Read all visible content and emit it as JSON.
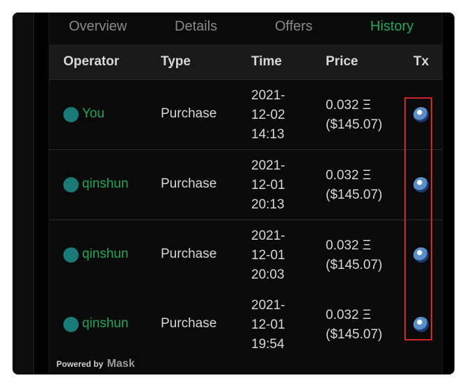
{
  "tabs": [
    "Overview",
    "Details",
    "Offers",
    "History"
  ],
  "active_tab": "History",
  "columns": {
    "operator": "Operator",
    "type": "Type",
    "time": "Time",
    "price": "Price",
    "tx": "Tx"
  },
  "rows": [
    {
      "operator": "You",
      "type": "Purchase",
      "time": [
        "2021-",
        "12-02",
        "14:13"
      ],
      "price": [
        "0.032 Ξ",
        "($145.07)"
      ],
      "tx_icon": "ethereum-explorer-icon"
    },
    {
      "operator": "qinshun",
      "type": "Purchase",
      "time": [
        "2021-",
        "12-01",
        "20:13"
      ],
      "price": [
        "0.032 Ξ",
        "($145.07)"
      ],
      "tx_icon": "ethereum-explorer-icon"
    },
    {
      "operator": "qinshun",
      "type": "Purchase",
      "time": [
        "2021-",
        "12-01",
        "20:03"
      ],
      "price": [
        "0.032 Ξ",
        "($145.07)"
      ],
      "tx_icon": "ethereum-explorer-icon"
    },
    {
      "operator": "qinshun",
      "type": "Purchase",
      "time": [
        "2021-",
        "12-01",
        "19:54"
      ],
      "price": [
        "0.032 Ξ",
        "($145.07)"
      ],
      "tx_icon": "ethereum-explorer-icon"
    }
  ],
  "footer": {
    "powered_by": "Powered by",
    "brand": "Mask"
  },
  "colors": {
    "accent": "#1aa85a",
    "avatar": "#1a7a78",
    "highlight": "#d0262a",
    "background": "#0a0a0a"
  }
}
